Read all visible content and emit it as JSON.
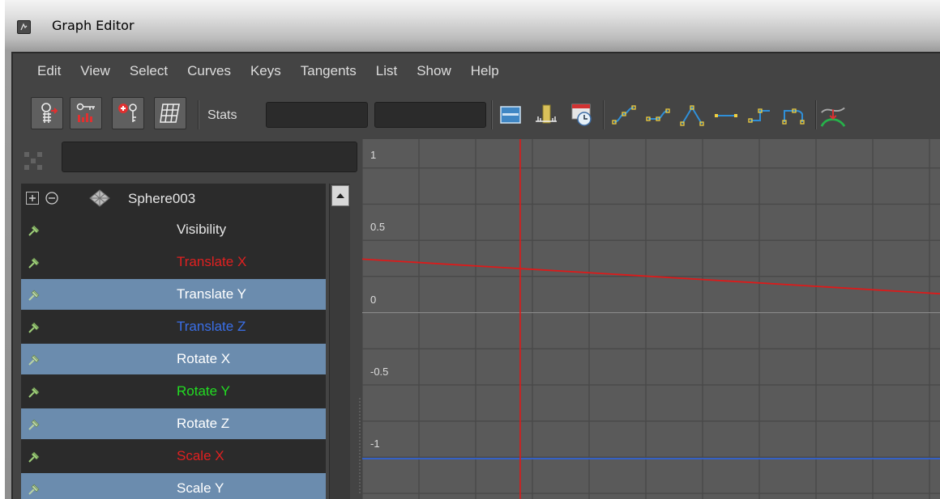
{
  "window": {
    "title": "Graph Editor"
  },
  "menu": [
    "Edit",
    "View",
    "Select",
    "Curves",
    "Keys",
    "Tangents",
    "List",
    "Show",
    "Help"
  ],
  "toolbar": {
    "stats_label": "Stats",
    "stats_field_1": "",
    "stats_field_2": ""
  },
  "outliner": {
    "filter_value": "",
    "object": {
      "name": "Sphere003",
      "expand_icon": "plus-box-icon",
      "collapse_icon": "minus-circle-icon",
      "object_icon": "mesh-icon"
    },
    "attributes": [
      {
        "label": "Visibility",
        "color": "#e6e6e6",
        "selected": false
      },
      {
        "label": "Translate X",
        "color": "#e02020",
        "selected": false
      },
      {
        "label": "Translate Y",
        "color": "#ffffff",
        "selected": true
      },
      {
        "label": "Translate Z",
        "color": "#3a6fe8",
        "selected": false
      },
      {
        "label": "Rotate X",
        "color": "#ffffff",
        "selected": true
      },
      {
        "label": "Rotate Y",
        "color": "#22dd22",
        "selected": false
      },
      {
        "label": "Rotate Z",
        "color": "#ffffff",
        "selected": true
      },
      {
        "label": "Scale X",
        "color": "#e02020",
        "selected": false
      },
      {
        "label": "Scale Y",
        "color": "#ffffff",
        "selected": true
      }
    ]
  },
  "graph": {
    "y_ticks": [
      "1",
      "0.5",
      "0",
      "-0.5",
      "-1"
    ],
    "y_range": [
      -1.3,
      1.2
    ],
    "curves": [
      {
        "name": "Translate X",
        "color": "#dd1a1a",
        "y_start": 0.37,
        "y_end": 0.13
      },
      {
        "name": "Translate Z",
        "color": "#2f62d8",
        "y_start": -1.01,
        "y_end": -1.01
      }
    ],
    "current_time_color": "#dd1a1a",
    "grid_color": "#494949",
    "zero_line_color": "#8a8a8a"
  },
  "colors": {
    "panel_bg": "#444444",
    "field_bg": "#2b2b2b",
    "selection": "#6b8cae",
    "graph_bg": "#5a5a5a"
  }
}
